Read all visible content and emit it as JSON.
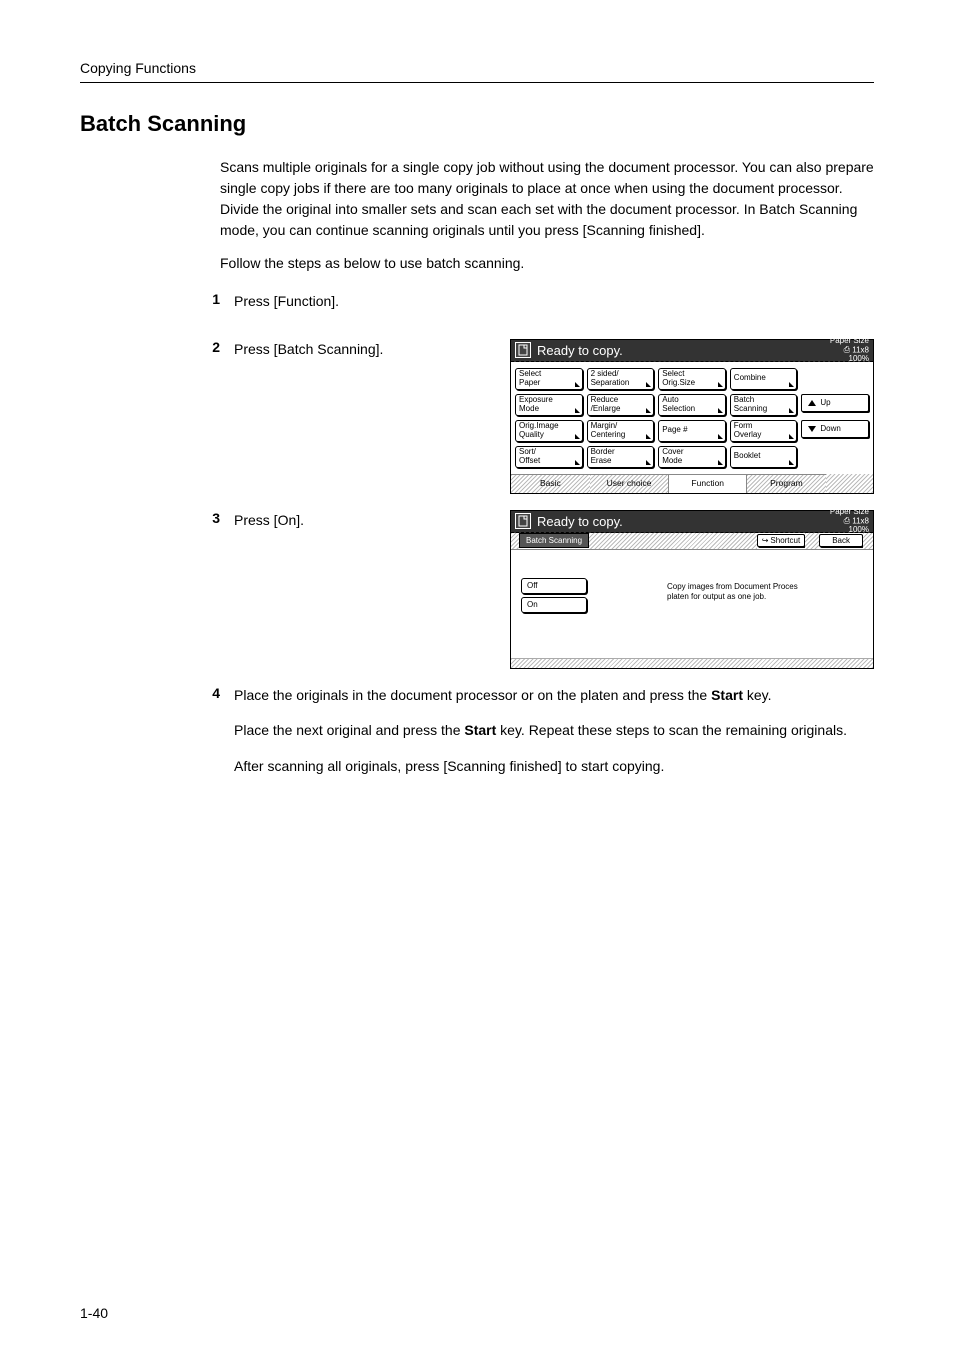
{
  "breadcrumb": "Copying Functions",
  "section_title": "Batch Scanning",
  "intro": "Scans multiple originals for a single copy job without using the document processor. You can also prepare single copy jobs if there are too many originals to place at once when using the document processor. Divide the original into smaller sets and scan each set with the document processor. In Batch Scanning mode, you can continue scanning originals until you press [Scanning finished].",
  "intro2": "Follow the steps as below to use batch scanning.",
  "steps": {
    "s1": {
      "num": "1",
      "text": "Press [Function]."
    },
    "s2": {
      "num": "2",
      "text": "Press [Batch Scanning]."
    },
    "s3": {
      "num": "3",
      "text": "Press [On]."
    },
    "s4": {
      "num": "4",
      "p1_a": "Place the originals in the document processor or on the platen and press the ",
      "p1_b": "Start",
      "p1_c": " key.",
      "p2_a": "Place the next original and press the ",
      "p2_b": "Start",
      "p2_c": " key. Repeat these steps to scan the remaining originals.",
      "p3": "After scanning all originals, press [Scanning finished] to start copying."
    }
  },
  "panel1": {
    "title": "Ready to copy.",
    "paper_label": "Paper Size",
    "paper_size": "11x8",
    "zoom": "100%",
    "grid": {
      "r1c1a": "Select",
      "r1c1b": "Paper",
      "r1c2a": "2 sided/",
      "r1c2b": "Separation",
      "r1c3a": "Select",
      "r1c3b": "Orig.Size",
      "r1c4": "Combine",
      "r2c1a": "Exposure",
      "r2c1b": "Mode",
      "r2c2a": "Reduce",
      "r2c2b": "/Enlarge",
      "r2c3a": "Auto",
      "r2c3b": "Selection",
      "r2c4a": "Batch",
      "r2c4b": "Scanning",
      "r2c5": "Up",
      "r3c1a": "Orig.Image",
      "r3c1b": "Quality",
      "r3c2a": "Margin/",
      "r3c2b": "Centering",
      "r3c3": "Page #",
      "r3c4a": "Form",
      "r3c4b": "Overlay",
      "r3c5": "Down",
      "r4c1a": "Sort/",
      "r4c1b": "Offset",
      "r4c2a": "Border",
      "r4c2b": "Erase",
      "r4c3a": "Cover",
      "r4c3b": "Mode",
      "r4c4": "Booklet"
    },
    "tabs": {
      "t1": "Basic",
      "t2": "User choice",
      "t3": "Function",
      "t4": "Program"
    }
  },
  "panel2": {
    "title": "Ready to copy.",
    "paper_label": "Paper Size",
    "paper_size": "11x8",
    "zoom": "100%",
    "crumb": "Batch Scanning",
    "shortcut": "Shortcut",
    "back": "Back",
    "off": "Off",
    "on": "On",
    "help1": "Copy images from Document Proces",
    "help2": "platen for output as one job."
  },
  "page_num": "1-40"
}
